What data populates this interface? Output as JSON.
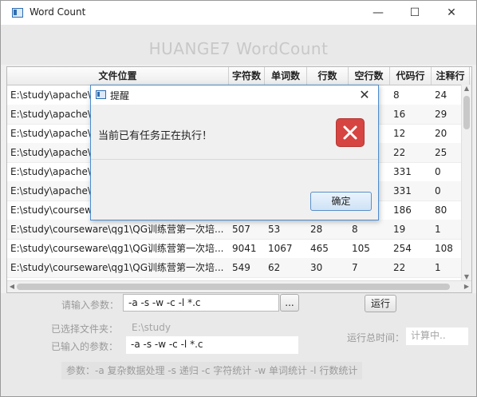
{
  "window": {
    "title": "Word Count",
    "controls": {
      "minimize": "—",
      "maximize": "☐",
      "close": "✕"
    }
  },
  "banner": {
    "title": "HUANGE7 WordCount"
  },
  "table": {
    "columns": [
      "文件位置",
      "字符数",
      "单词数",
      "行数",
      "空行数",
      "代码行",
      "注释行"
    ],
    "rows": [
      [
        "E:\\study\\apache\\a",
        "",
        "",
        "",
        "",
        "8",
        "24"
      ],
      [
        "E:\\study\\apache\\a",
        "",
        "",
        "",
        "",
        "16",
        "29"
      ],
      [
        "E:\\study\\apache\\a",
        "",
        "",
        "",
        "",
        "12",
        "20"
      ],
      [
        "E:\\study\\apache\\a",
        "",
        "",
        "",
        "",
        "22",
        "25"
      ],
      [
        "E:\\study\\apache\\a",
        "",
        "",
        "",
        "",
        "331",
        "0"
      ],
      [
        "E:\\study\\apache\\A",
        "",
        "",
        "",
        "",
        "331",
        "0"
      ],
      [
        "E:\\study\\courseware",
        "",
        "",
        "",
        "",
        "186",
        "80"
      ],
      [
        "E:\\study\\courseware\\qg1\\QG训练营第一次培...",
        "507",
        "53",
        "28",
        "8",
        "19",
        "1"
      ],
      [
        "E:\\study\\courseware\\qg1\\QG训练营第一次培...",
        "9041",
        "1067",
        "465",
        "105",
        "254",
        "108"
      ],
      [
        "E:\\study\\courseware\\qg1\\QG训练营第一次培...",
        "549",
        "62",
        "30",
        "7",
        "22",
        "1"
      ]
    ]
  },
  "form": {
    "params_label": "请输入参数：",
    "params_value": "-a -s -w -c -l *.c",
    "browse_label": "...",
    "run_label": "运行",
    "selected_folder_label": "已选择文件夹：",
    "selected_folder_value": "E:\\study",
    "entered_params_label": "已输入的参数：",
    "entered_params_value": "-a -s -w -c -l *.c",
    "runtime_label": "运行总时间：",
    "runtime_value": "计算中..",
    "hint": "参数：-a 复杂数据处理   -s 递归   -c 字符统计  -w 单词统计  -l 行数统计"
  },
  "dialog": {
    "title": "提醒",
    "message": "当前已有任务正在执行！",
    "ok_label": "确定",
    "close": "✕"
  },
  "colors": {
    "error_icon": "#d64541",
    "dialog_border": "#4a8dd0",
    "ok_button": "#cfe2f6"
  },
  "icons": [
    "app-icon",
    "error-icon",
    "close-icon",
    "minimize-icon",
    "maximize-icon"
  ]
}
